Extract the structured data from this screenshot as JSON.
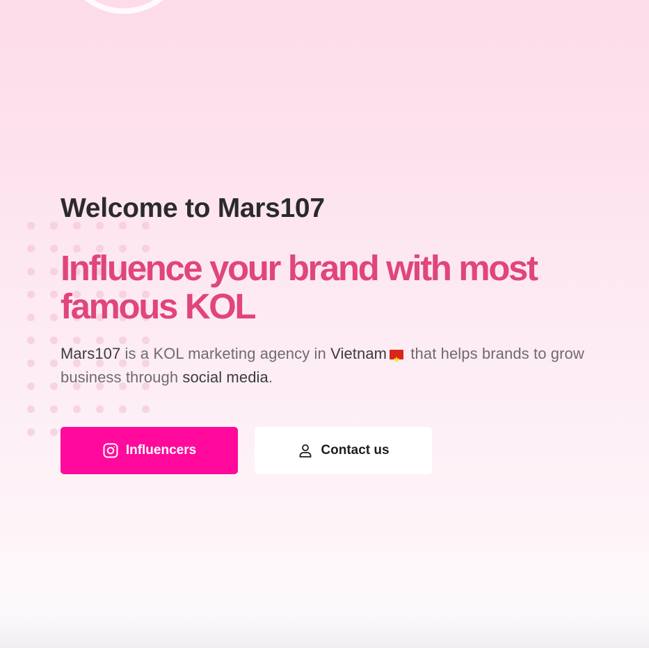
{
  "hero": {
    "welcome": "Welcome to Mars107",
    "headline": "Influence your brand with most famous KOL",
    "description": {
      "part1": "Mars107",
      "part2": " is a KOL marketing agency in ",
      "part3": "Vietnam",
      "part4": " that helps brands to grow business through ",
      "part5": "social media",
      "part6": "."
    }
  },
  "actions": {
    "influencers_label": "Influencers",
    "contact_label": "Contact us"
  },
  "icons": {
    "influencers": "instagram-icon",
    "contact": "user-icon",
    "flag": "vietnam-flag-icon"
  },
  "colors": {
    "accent": "#ff0a9c",
    "headline": "#e0457b",
    "text_dark": "#2b2a2e"
  }
}
